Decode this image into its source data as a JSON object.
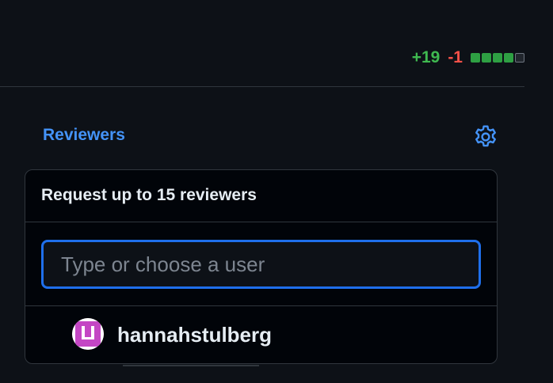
{
  "diffstat": {
    "additions": "+19",
    "deletions": "-1",
    "blocks": [
      "added",
      "added",
      "added",
      "added",
      "neutral"
    ],
    "colors": {
      "added": "#2ea043",
      "neutral": "#21262d",
      "additions_text": "#3fb950",
      "deletions_text": "#f85149"
    }
  },
  "reviewers": {
    "heading": "Reviewers",
    "settings_icon": "gear-icon",
    "accent_color": "#4493f8"
  },
  "popup": {
    "title": "Request up to 15 reviewers",
    "search_placeholder": "Type or choose a user",
    "search_value": "",
    "users": [
      {
        "username": "hannahstulberg",
        "avatar_icon": "identicon-avatar",
        "avatar_color": "#c446c4"
      }
    ]
  }
}
